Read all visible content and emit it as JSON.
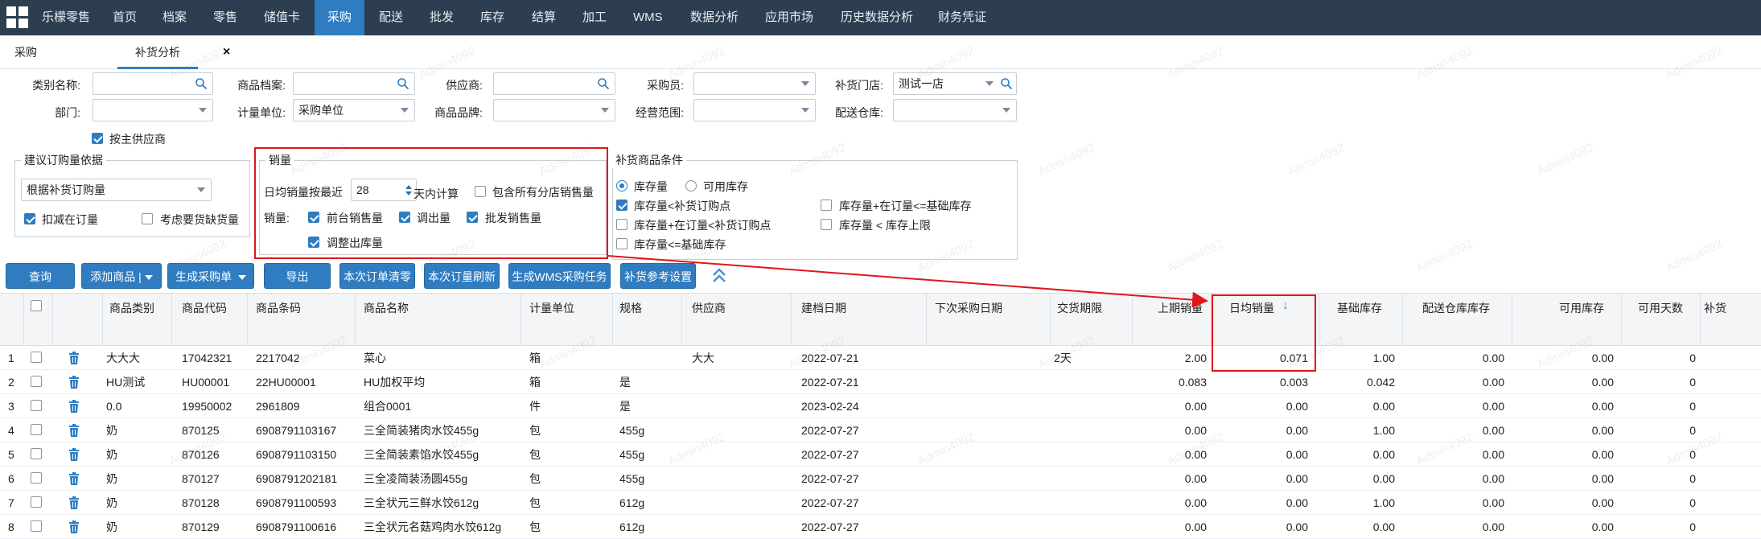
{
  "nav": {
    "items": [
      "乐檬零售",
      "首页",
      "档案",
      "零售",
      "储值卡",
      "采购",
      "配送",
      "批发",
      "库存",
      "结算",
      "加工",
      "WMS",
      "数据分析",
      "应用市场",
      "历史数据分析",
      "财务凭证"
    ],
    "active": "采购"
  },
  "tabs": {
    "first": "采购",
    "active": "补货分析",
    "close": "×"
  },
  "filters": {
    "category_label": "类别名称:",
    "product_label": "商品档案:",
    "supplier_label": "供应商:",
    "buyer_label": "采购员:",
    "store_label": "补货门店:",
    "store_value": "测试一店",
    "dept_label": "部门:",
    "unit_label": "计量单位:",
    "unit_value": "采购单位",
    "brand_label": "商品品牌:",
    "scope_label": "经营范围:",
    "warehouse_label": "配送仓库:",
    "main_supplier": "按主供应商"
  },
  "basis": {
    "legend": "建议订购量依据",
    "value": "根据补货订购量",
    "deduct_onorder": "扣减在订量",
    "consider_shortage": "考虑要货缺货量"
  },
  "sales": {
    "legend": "销量",
    "avg_prefix": "日均销量按最近",
    "days": "28",
    "avg_suffix": "天内计算",
    "include_all": "包含所有分店销售量",
    "sales_label": "销量:",
    "front_sales": "前台销售量",
    "transfer_out": "调出量",
    "wholesale": "批发销售量",
    "adjust_out": "调整出库量"
  },
  "conditions": {
    "legend": "补货商品条件",
    "stock": "库存量",
    "available_stock": "可用库存",
    "lt_reorder": "库存量<补货订购点",
    "plus_onorder_le_base": "库存量+在订量<=基础库存",
    "plus_onorder_lt_reorder": "库存量+在订量<补货订购点",
    "lt_upper": "库存量 < 库存上限",
    "le_base": "库存量<=基础库存"
  },
  "toolbar": {
    "query": "查询",
    "add_product": "添加商品",
    "generate_po": "生成采购单",
    "export": "导出",
    "clear_order": "本次订单清零",
    "refresh_order": "本次订量刷新",
    "generate_wms": "生成WMS采购任务",
    "ref_settings": "补货参考设置"
  },
  "table": {
    "headers": {
      "category": "商品类别",
      "code": "商品代码",
      "barcode": "商品条码",
      "name": "商品名称",
      "unit": "计量单位",
      "spec": "规格",
      "supplier": "供应商",
      "created": "建档日期",
      "next_po": "下次采购日期",
      "lead": "交货期限",
      "last_sales": "上期销量",
      "daily_sales": "日均销量",
      "base_stock": "基础库存",
      "dist_stock": "配送仓库库存",
      "avail_stock": "可用库存",
      "avail_days": "可用天数",
      "replenish": "补货"
    },
    "sort_icon": "arrow-down-icon",
    "rows": [
      {
        "no": "1",
        "category": "大大大",
        "code": "17042321",
        "barcode": "2217042",
        "name": "菜心",
        "unit": "箱",
        "spec": "",
        "supplier": "大大",
        "created": "2022-07-21",
        "next": "",
        "lead": "2天",
        "last": "2.00",
        "daily": "0.071",
        "base": "1.00",
        "dist": "0.00",
        "avail": "0.00",
        "days": "0"
      },
      {
        "no": "2",
        "category": "HU测试",
        "code": "HU00001",
        "barcode": "22HU00001",
        "name": "HU加权平均",
        "unit": "箱",
        "spec": "是",
        "supplier": "",
        "created": "2022-07-21",
        "next": "",
        "lead": "",
        "last": "0.083",
        "daily": "0.003",
        "base": "0.042",
        "dist": "0.00",
        "avail": "0.00",
        "days": "0"
      },
      {
        "no": "3",
        "category": "0.0",
        "code": "19950002",
        "barcode": "2961809",
        "name": "组合0001",
        "unit": "件",
        "spec": "是",
        "supplier": "",
        "created": "2023-02-24",
        "next": "",
        "lead": "",
        "last": "0.00",
        "daily": "0.00",
        "base": "0.00",
        "dist": "0.00",
        "avail": "0.00",
        "days": "0"
      },
      {
        "no": "4",
        "category": "奶",
        "code": "870125",
        "barcode": "6908791103167",
        "name": "三全简装猪肉水饺455g",
        "unit": "包",
        "spec": "455g",
        "supplier": "",
        "created": "2022-07-27",
        "next": "",
        "lead": "",
        "last": "0.00",
        "daily": "0.00",
        "base": "1.00",
        "dist": "0.00",
        "avail": "0.00",
        "days": "0"
      },
      {
        "no": "5",
        "category": "奶",
        "code": "870126",
        "barcode": "6908791103150",
        "name": "三全简装素馅水饺455g",
        "unit": "包",
        "spec": "455g",
        "supplier": "",
        "created": "2022-07-27",
        "next": "",
        "lead": "",
        "last": "0.00",
        "daily": "0.00",
        "base": "0.00",
        "dist": "0.00",
        "avail": "0.00",
        "days": "0"
      },
      {
        "no": "6",
        "category": "奶",
        "code": "870127",
        "barcode": "6908791202181",
        "name": "三全凌简装汤圆455g",
        "unit": "包",
        "spec": "455g",
        "supplier": "",
        "created": "2022-07-27",
        "next": "",
        "lead": "",
        "last": "0.00",
        "daily": "0.00",
        "base": "0.00",
        "dist": "0.00",
        "avail": "0.00",
        "days": "0"
      },
      {
        "no": "7",
        "category": "奶",
        "code": "870128",
        "barcode": "6908791100593",
        "name": "三全状元三鲜水饺612g",
        "unit": "包",
        "spec": "612g",
        "supplier": "",
        "created": "2022-07-27",
        "next": "",
        "lead": "",
        "last": "0.00",
        "daily": "0.00",
        "base": "1.00",
        "dist": "0.00",
        "avail": "0.00",
        "days": "0"
      },
      {
        "no": "8",
        "category": "奶",
        "code": "870129",
        "barcode": "6908791100616",
        "name": "三全状元名菇鸡肉水饺612g",
        "unit": "包",
        "spec": "612g",
        "supplier": "",
        "created": "2022-07-27",
        "next": "",
        "lead": "",
        "last": "0.00",
        "daily": "0.00",
        "base": "0.00",
        "dist": "0.00",
        "avail": "0.00",
        "days": "0"
      }
    ]
  },
  "watermark": "Admin4092",
  "colors": {
    "nav_bg": "#2c3e50",
    "accent": "#2f7cc1",
    "highlight": "#e0161b"
  }
}
